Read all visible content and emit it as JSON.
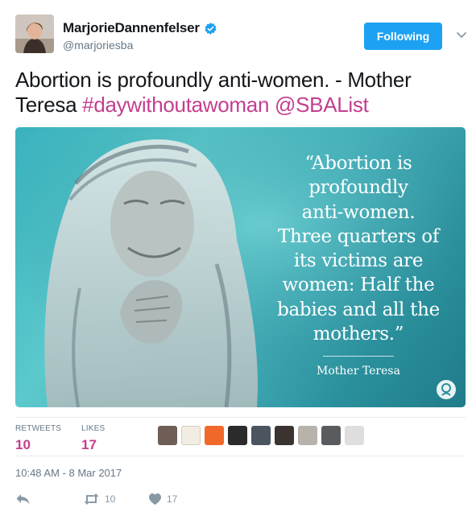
{
  "user": {
    "display_name": "MarjorieDannenfelser",
    "handle": "@marjoriesba",
    "verified_icon": "verified-badge-icon",
    "avatar_icon": "profile-avatar"
  },
  "follow_button": {
    "label": "Following"
  },
  "tweet": {
    "text_plain": "Abortion is profoundly anti-women. - Mother Teresa ",
    "hashtag": "#daywithoutawoman",
    "mention": "@SBAList"
  },
  "media": {
    "quote_lines": [
      "“Abortion is",
      "profoundly",
      "anti-women.",
      "Three quarters of",
      "its victims are",
      "women: Half the",
      "babies and all the",
      "mothers.”"
    ],
    "attribution": "Mother Teresa"
  },
  "stats": {
    "retweets_label": "RETWEETS",
    "retweets_count": "10",
    "likes_label": "LIKES",
    "likes_count": "17"
  },
  "timestamp": "10:48 AM - 8 Mar 2017",
  "actions": {
    "reply_icon": "reply-icon",
    "retweet_icon": "retweet-icon",
    "retweet_count": "10",
    "like_icon": "heart-icon",
    "like_count": "17"
  },
  "colors": {
    "accent_blue": "#1da1f2",
    "link_pink": "#c43e8f",
    "muted_gray": "#657786",
    "media_teal": "#4bbcc4"
  }
}
